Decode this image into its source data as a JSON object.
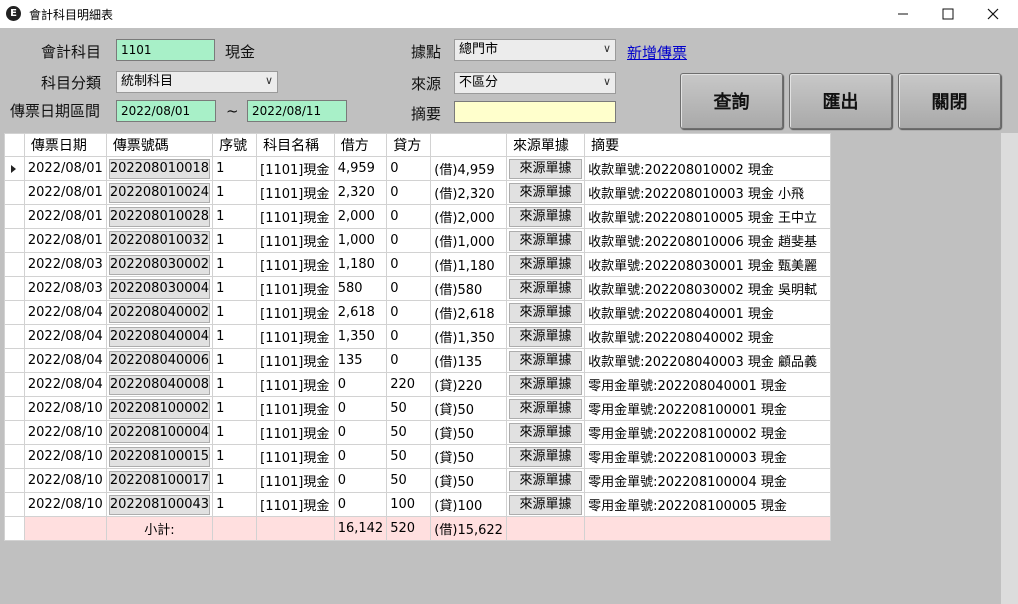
{
  "window": {
    "title": "會計科目明細表",
    "icon": "app-logo-icon"
  },
  "form": {
    "account_label": "會計科目",
    "account_code": "1101",
    "account_name": "現金",
    "category_label": "科目分類",
    "category_value": "統制科目",
    "date_range_label": "傳票日期區間",
    "date_from": "2022/08/01",
    "date_separator": "~",
    "date_to": "2022/08/11",
    "site_label": "據點",
    "site_value": "總門市",
    "new_voucher_link": "新增傳票",
    "source_label": "來源",
    "source_value": "不區分",
    "summary_label": "摘要",
    "summary_value": ""
  },
  "buttons": {
    "query": "查詢",
    "export": "匯出",
    "close": "關閉"
  },
  "table": {
    "columns": [
      "傳票日期",
      "傳票號碼",
      "序號",
      "科目名稱",
      "借方",
      "貸方",
      "",
      "來源單據",
      "摘要"
    ],
    "rows": [
      [
        "2022/08/01",
        "202208010018",
        "1",
        "[1101]現金",
        "4,959",
        "0",
        "(借)4,959",
        "來源單據",
        "收款單號:202208010002 現金"
      ],
      [
        "2022/08/01",
        "202208010024",
        "1",
        "[1101]現金",
        "2,320",
        "0",
        "(借)2,320",
        "來源單據",
        "收款單號:202208010003 現金 小飛"
      ],
      [
        "2022/08/01",
        "202208010028",
        "1",
        "[1101]現金",
        "2,000",
        "0",
        "(借)2,000",
        "來源單據",
        "收款單號:202208010005 現金 王中立"
      ],
      [
        "2022/08/01",
        "202208010032",
        "1",
        "[1101]現金",
        "1,000",
        "0",
        "(借)1,000",
        "來源單據",
        "收款單號:202208010006 現金 趙斐基"
      ],
      [
        "2022/08/03",
        "202208030002",
        "1",
        "[1101]現金",
        "1,180",
        "0",
        "(借)1,180",
        "來源單據",
        "收款單號:202208030001 現金 甄美麗"
      ],
      [
        "2022/08/03",
        "202208030004",
        "1",
        "[1101]現金",
        "580",
        "0",
        "(借)580",
        "來源單據",
        "收款單號:202208030002 現金 吳明軾"
      ],
      [
        "2022/08/04",
        "202208040002",
        "1",
        "[1101]現金",
        "2,618",
        "0",
        "(借)2,618",
        "來源單據",
        "收款單號:202208040001 現金"
      ],
      [
        "2022/08/04",
        "202208040004",
        "1",
        "[1101]現金",
        "1,350",
        "0",
        "(借)1,350",
        "來源單據",
        "收款單號:202208040002 現金"
      ],
      [
        "2022/08/04",
        "202208040006",
        "1",
        "[1101]現金",
        "135",
        "0",
        "(借)135",
        "來源單據",
        "收款單號:202208040003 現金 顧品義"
      ],
      [
        "2022/08/04",
        "202208040008",
        "1",
        "[1101]現金",
        "0",
        "220",
        "(貸)220",
        "來源單據",
        "零用金單號:202208040001 現金"
      ],
      [
        "2022/08/10",
        "202208100002",
        "1",
        "[1101]現金",
        "0",
        "50",
        "(貸)50",
        "來源單據",
        "零用金單號:202208100001 現金"
      ],
      [
        "2022/08/10",
        "202208100004",
        "1",
        "[1101]現金",
        "0",
        "50",
        "(貸)50",
        "來源單據",
        "零用金單號:202208100002 現金"
      ],
      [
        "2022/08/10",
        "202208100015",
        "1",
        "[1101]現金",
        "0",
        "50",
        "(貸)50",
        "來源單據",
        "零用金單號:202208100003 現金"
      ],
      [
        "2022/08/10",
        "202208100017",
        "1",
        "[1101]現金",
        "0",
        "50",
        "(貸)50",
        "來源單據",
        "零用金單號:202208100004 現金"
      ],
      [
        "2022/08/10",
        "202208100043",
        "1",
        "[1101]現金",
        "0",
        "100",
        "(貸)100",
        "來源單據",
        "零用金單號:202208100005 現金"
      ]
    ],
    "subtotal": {
      "label": "小計:",
      "debit": "16,142",
      "credit": "520",
      "balance": "(借)15,622"
    }
  }
}
